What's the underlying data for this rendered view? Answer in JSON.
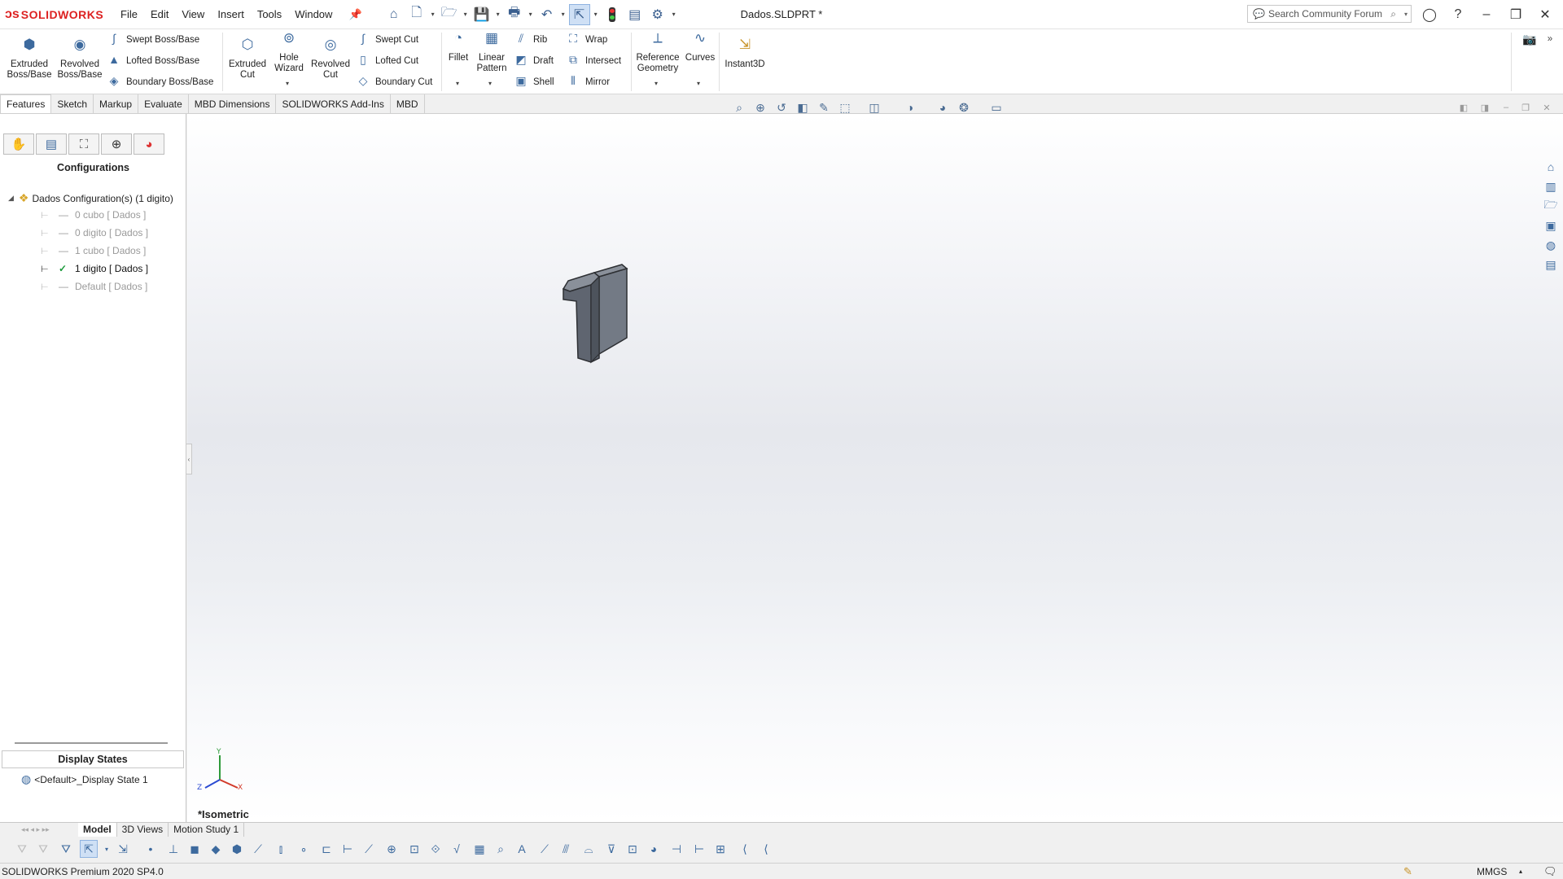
{
  "app": {
    "logo_mark": "ↄs",
    "logo_text": "SOLIDWORKS",
    "document_title": "Dados.SLDPRT *"
  },
  "menu": [
    "File",
    "Edit",
    "View",
    "Insert",
    "Tools",
    "Window"
  ],
  "search": {
    "placeholder": "Search Community Forum"
  },
  "ribbon": {
    "extruded_boss": [
      "Extruded",
      "Boss/Base"
    ],
    "revolved_boss": [
      "Revolved",
      "Boss/Base"
    ],
    "swept_boss": "Swept Boss/Base",
    "lofted_boss": "Lofted Boss/Base",
    "boundary_boss": "Boundary Boss/Base",
    "extruded_cut": [
      "Extruded",
      "Cut"
    ],
    "hole_wizard": [
      "Hole",
      "Wizard"
    ],
    "revolved_cut": [
      "Revolved",
      "Cut"
    ],
    "swept_cut": "Swept Cut",
    "lofted_cut": "Lofted Cut",
    "boundary_cut": "Boundary Cut",
    "fillet": "Fillet",
    "linear_pattern": [
      "Linear",
      "Pattern"
    ],
    "rib": "Rib",
    "draft": "Draft",
    "shell": "Shell",
    "wrap": "Wrap",
    "intersect": "Intersect",
    "mirror": "Mirror",
    "reference_geometry": [
      "Reference",
      "Geometry"
    ],
    "curves": "Curves",
    "instant3d": "Instant3D"
  },
  "tabs": [
    "Features",
    "Sketch",
    "Markup",
    "Evaluate",
    "MBD Dimensions",
    "SOLIDWORKS Add-Ins",
    "MBD"
  ],
  "panel": {
    "heading": "Configurations",
    "root_label": "Dados Configuration(s)  (1 digito)",
    "items": [
      {
        "label": "0 cubo [ Dados ]",
        "active": false
      },
      {
        "label": "0 digito [ Dados ]",
        "active": false
      },
      {
        "label": "1 cubo [ Dados ]",
        "active": false
      },
      {
        "label": "1 digito [ Dados ]",
        "active": true
      },
      {
        "label": "Default [ Dados ]",
        "active": false
      }
    ],
    "display_states_heading": "Display States",
    "display_state_item": "<Default>_Display State 1"
  },
  "viewport": {
    "view_label": "*Isometric",
    "triad_axes": [
      "Y",
      "X",
      "Z"
    ]
  },
  "bottom_tabs": [
    "Model",
    "3D Views",
    "Motion Study 1"
  ],
  "status": {
    "left": "SOLIDWORKS Premium 2020 SP4.0",
    "units": "MMGS"
  },
  "colors": {
    "brand": "#d22222",
    "accent": "#3d6a9e",
    "check": "#1a9a3a",
    "part_face": "#6e7580"
  }
}
